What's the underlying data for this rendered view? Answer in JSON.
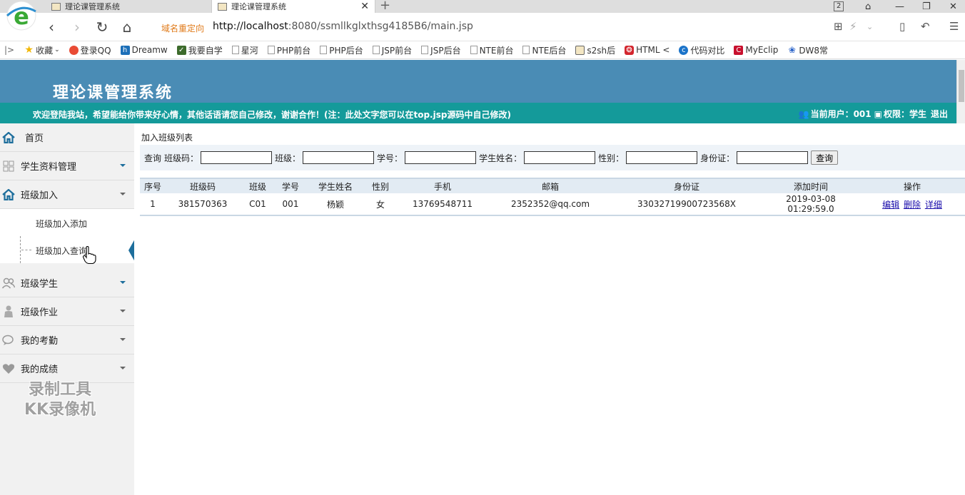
{
  "browser": {
    "tabs": [
      {
        "title": "理论课管理系统"
      },
      {
        "title": "理论课管理系统"
      }
    ],
    "tab_count": "2",
    "redirect_label": "域名重定向",
    "url_host": "http://localhost",
    "url_rest": ":8080/ssmllkglxthsg4185B6/main.jsp",
    "bookmarks": [
      "收藏",
      "登录QQ",
      "Dreamw",
      "我要自学",
      "星河",
      "PHP前台",
      "PHP后台",
      "JSP前台",
      "JSP后台",
      "NTE前台",
      "NTE后台",
      "s2sh后",
      "HTML <",
      "代码对比",
      "MyEclip",
      "DW8常"
    ]
  },
  "site": {
    "title": "理论课管理系统",
    "welcome": "欢迎登陆我站，希望能给你带来好心情，其他话语请您自己修改，谢谢合作！(注：此处文字您可以在top.jsp源码中自己修改)",
    "current_user": "当前用户：001",
    "permission": "权限：学生",
    "logout": "退出"
  },
  "sidebar": {
    "home": "首页",
    "items": [
      {
        "label": "学生资料管理"
      },
      {
        "label": "班级加入"
      },
      {
        "label": "班级学生"
      },
      {
        "label": "班级作业"
      },
      {
        "label": "我的考勤"
      },
      {
        "label": "我的成绩"
      }
    ],
    "subitems": [
      {
        "label": "班级加入添加"
      },
      {
        "label": "班级加入查询"
      }
    ]
  },
  "main": {
    "breadcrumb": "加入班级列表",
    "search": {
      "prefix": "查询",
      "fields": [
        {
          "label": "班级码："
        },
        {
          "label": "班级："
        },
        {
          "label": "学号："
        },
        {
          "label": "学生姓名："
        },
        {
          "label": "性别："
        },
        {
          "label": "身份证："
        }
      ],
      "button": "查询"
    },
    "table": {
      "headers": [
        "序号",
        "班级码",
        "班级",
        "学号",
        "学生姓名",
        "性别",
        "手机",
        "邮箱",
        "身份证",
        "添加时间",
        "操作"
      ],
      "rows": [
        {
          "cells": [
            "1",
            "381570363",
            "C01",
            "001",
            "杨颖",
            "女",
            "13769548711",
            "2352352@qq.com",
            "33032719900723568X",
            "2019-03-08 01:29:59.0"
          ],
          "actions": [
            "编辑",
            "删除",
            "详细"
          ]
        }
      ]
    }
  },
  "watermark": {
    "line1": "录制工具",
    "line2": "KK录像机"
  },
  "colors": {
    "header": "#4a8cb5",
    "bar": "#149a9a",
    "sidebar": "#f1f1f1",
    "accent": "#1d6e9c"
  }
}
